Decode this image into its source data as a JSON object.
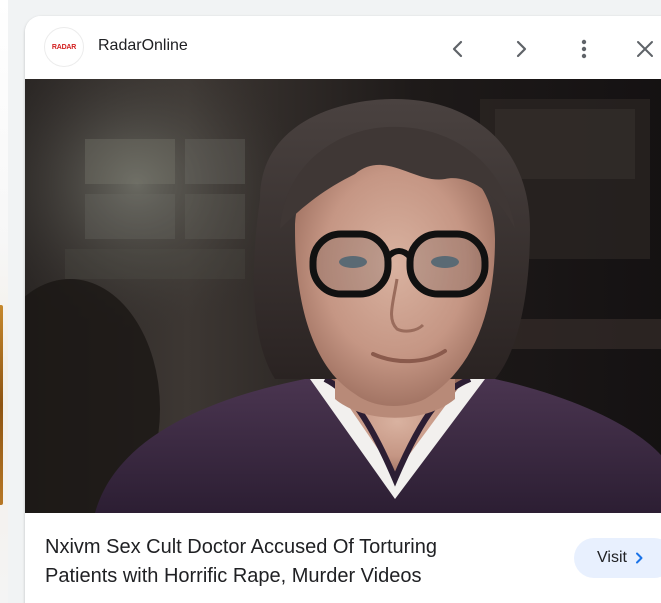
{
  "source": {
    "name": "RadarOnline",
    "logo_text": "RADAR",
    "logo_color": "#d21f1f"
  },
  "header": {
    "prev_icon": "chevron-left-icon",
    "next_icon": "chevron-right-icon",
    "more_icon": "more-vert-icon",
    "close_icon": "close-icon"
  },
  "image": {
    "lens_icon": "google-lens-icon"
  },
  "article": {
    "headline_line1": "Nxivm Sex Cult Doctor Accused Of Torturing",
    "headline_line2": "Patients with Horrific Rape, Murder Videos"
  },
  "visit": {
    "label": "Visit",
    "icon": "chevron-right-icon",
    "accent": "#1a73e8",
    "background": "#e8f0fe"
  }
}
